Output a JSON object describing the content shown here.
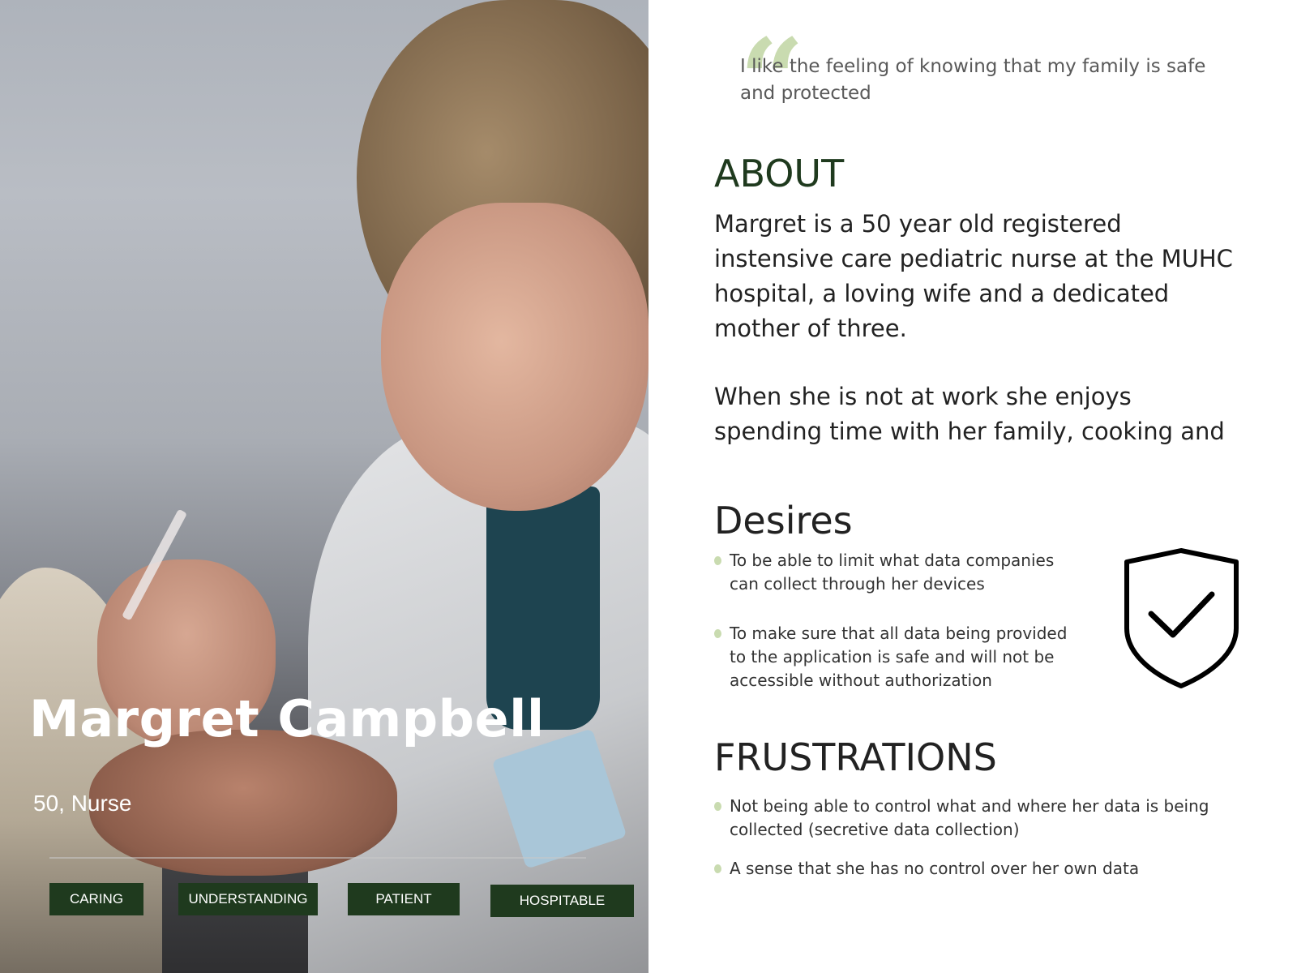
{
  "persona": {
    "name": "Margret Campbell",
    "age_occupation": "50, Nurse",
    "traits": [
      "CARING",
      "UNDERSTANDING",
      "PATIENT",
      "HOSPITABLE"
    ]
  },
  "quote": "I like the feeling of knowing that my family is safe and protected",
  "about": {
    "title": "ABOUT",
    "paragraphs": [
      "Margret is a 50 year old registered instensive care pediatric nurse at the MUHC hospital, a loving wife and a dedicated mother of three.",
      "When she is not at work she enjoys spending time with her family, cooking and"
    ]
  },
  "desires": {
    "title": "Desires",
    "items": [
      "To be able to limit what data companies can collect through her devices",
      "To make sure that all data being provided to the application is safe and will not be accessible without authorization"
    ]
  },
  "frustrations": {
    "title": "FRUSTRATIONS",
    "items": [
      "Not being able to control what and where her data is being collected (secretive data collection)",
      "A sense that she has no control over her own data"
    ]
  },
  "colors": {
    "accent_dark_green": "#1f3a1e",
    "accent_light_green": "#c9dbb0",
    "text_dark": "#222222"
  },
  "icons": {
    "quote": "quote-mark-icon",
    "shield": "shield-check-icon"
  }
}
